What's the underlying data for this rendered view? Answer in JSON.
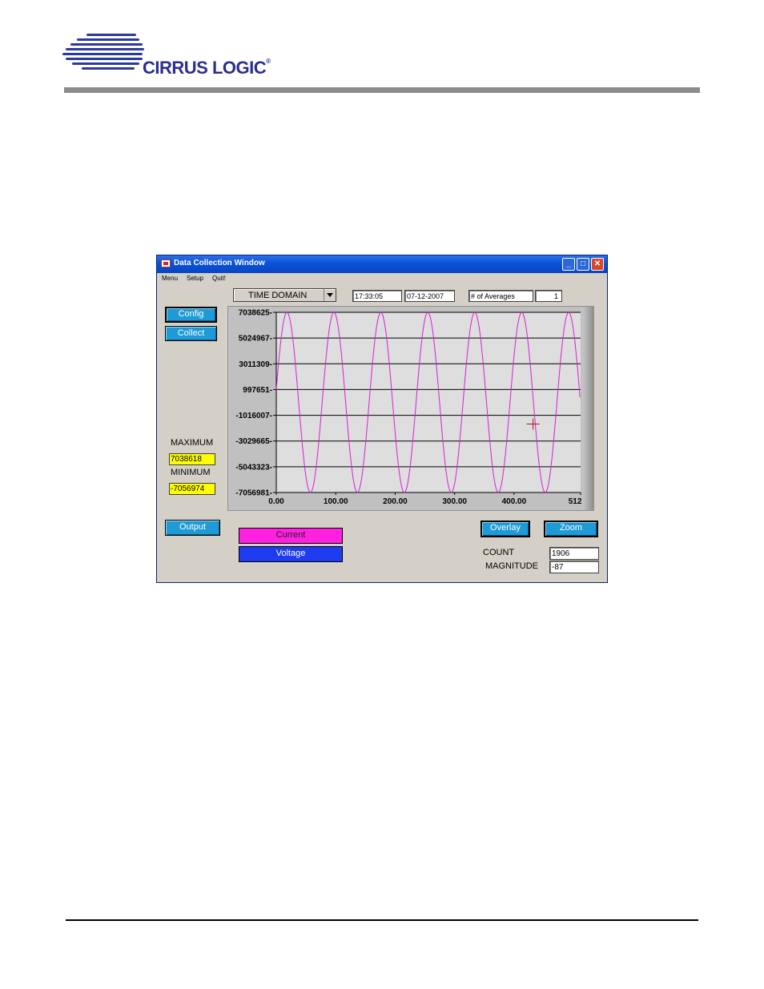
{
  "header": {
    "logo_text": "CIRRUS LOGIC"
  },
  "window": {
    "title": "Data Collection Window",
    "menu": [
      "Menu",
      "Setup",
      "Quit!"
    ],
    "mode_select": "TIME DOMAIN",
    "time": "17:33:05",
    "date": "07-12-2007",
    "averages_label": "# of Averages",
    "averages_value": "1",
    "buttons": {
      "config": "Config",
      "collect": "Collect",
      "output": "Output",
      "overlay": "Overlay",
      "zoom": "Zoom"
    },
    "stats": {
      "maximum_label": "MAXIMUM",
      "maximum_value": "7038618",
      "minimum_label": "MINIMUM",
      "minimum_value": "-7056974"
    },
    "legend": {
      "current": "Current",
      "voltage": "Voltage"
    },
    "count_label": "COUNT",
    "count_value": "1906",
    "magnitude_label": "MAGNITUDE",
    "magnitude_value": "-87"
  },
  "chart_data": {
    "type": "line",
    "title": "",
    "xlabel": "",
    "ylabel": "",
    "xlim": [
      0,
      512
    ],
    "ylim": [
      -7056981,
      7038625
    ],
    "x_ticks": [
      "0.00",
      "100.00",
      "200.00",
      "300.00",
      "400.00",
      "512.00"
    ],
    "x_tick_values": [
      0,
      100,
      200,
      300,
      400,
      512
    ],
    "y_ticks": [
      "7038625",
      "5024967",
      "3011309",
      "997651",
      "-1016007",
      "-3029665",
      "-5043323",
      "-7056981"
    ],
    "y_tick_values": [
      7038625,
      5024967,
      3011309,
      997651,
      -1016007,
      -3029665,
      -5043323,
      -7056981
    ],
    "grid": true,
    "series": [
      {
        "color": "#d81ed8",
        "function": "sine",
        "amplitude": 7038618,
        "offset": -9178,
        "period_samples": 79,
        "phase_start_value": 997651,
        "samples": 512
      }
    ],
    "cursor": {
      "x": 432,
      "y": -1700000
    }
  }
}
